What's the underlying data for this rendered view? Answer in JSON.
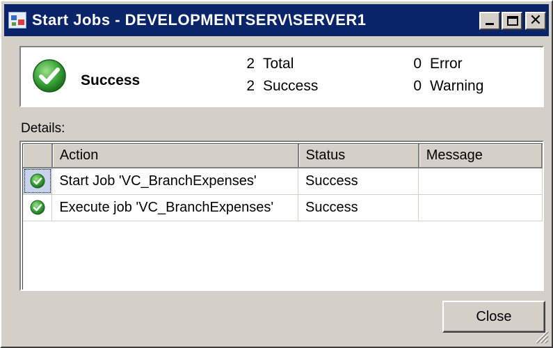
{
  "window": {
    "title": "Start Jobs - DEVELOPMENTSERV\\SERVER1",
    "title_bar_color": "#0a246a",
    "controls": [
      "minimize-icon",
      "maximize-icon",
      "close-icon"
    ]
  },
  "summary": {
    "status": "Success",
    "status_icon": "success-check-icon",
    "stats": {
      "total_count": "2",
      "total_label": "Total",
      "success_count": "2",
      "success_label": "Success",
      "error_count": "0",
      "error_label": "Error",
      "warning_count": "0",
      "warning_label": "Warning"
    }
  },
  "details": {
    "label": "Details:",
    "columns": [
      "Action",
      "Status",
      "Message"
    ],
    "rows": [
      {
        "icon": "success-check-icon",
        "action": "Start Job 'VC_BranchExpenses'",
        "status": "Success",
        "message": ""
      },
      {
        "icon": "success-check-icon",
        "action": "Execute job 'VC_BranchExpenses'",
        "status": "Success",
        "message": ""
      }
    ]
  },
  "buttons": {
    "close_label": "Close"
  },
  "colors": {
    "success_green": "#3aa63a",
    "dialog_face": "#d4d0c8"
  }
}
